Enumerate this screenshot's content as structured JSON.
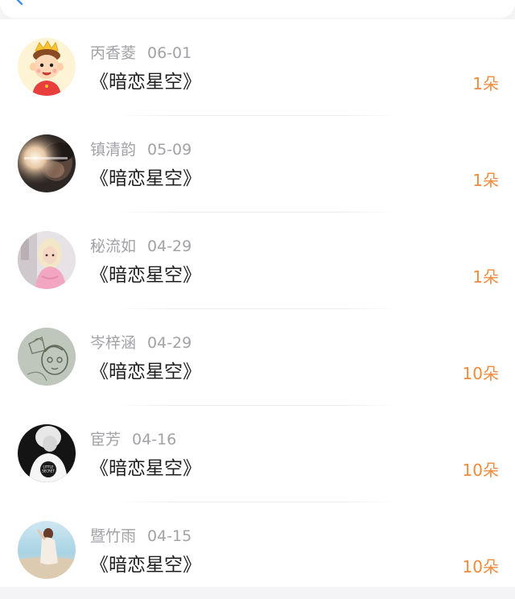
{
  "header": {
    "search_icon": "search-icon"
  },
  "gifts": [
    {
      "name": "丙香菱",
      "date": "06-01",
      "title": "《暗恋星空》",
      "count": "1朵",
      "avatar": "cartoon-boy-crown"
    },
    {
      "name": "镇清韵",
      "date": "05-09",
      "title": "《暗恋星空》",
      "count": "1朵",
      "avatar": "dark-portrait-flare"
    },
    {
      "name": "秘流如",
      "date": "04-29",
      "title": "《暗恋星空》",
      "count": "1朵",
      "avatar": "girl-pink-sweater"
    },
    {
      "name": "岑梓涵",
      "date": "04-29",
      "title": "《暗恋星空》",
      "count": "10朵",
      "avatar": "sketch-drawing"
    },
    {
      "name": "宦芳",
      "date": "04-16",
      "title": "《暗恋星空》",
      "count": "10朵",
      "avatar": "little-secret-shirt"
    },
    {
      "name": "暨竹雨",
      "date": "04-15",
      "title": "《暗恋星空》",
      "count": "10朵",
      "avatar": "beach-girl"
    }
  ],
  "avatar_badge_text": "LITTLE SECRET",
  "colors": {
    "count": "#f08b3c",
    "title": "#1f1f1f",
    "meta": "#a2a2a8",
    "background": "#f4f4f6"
  }
}
